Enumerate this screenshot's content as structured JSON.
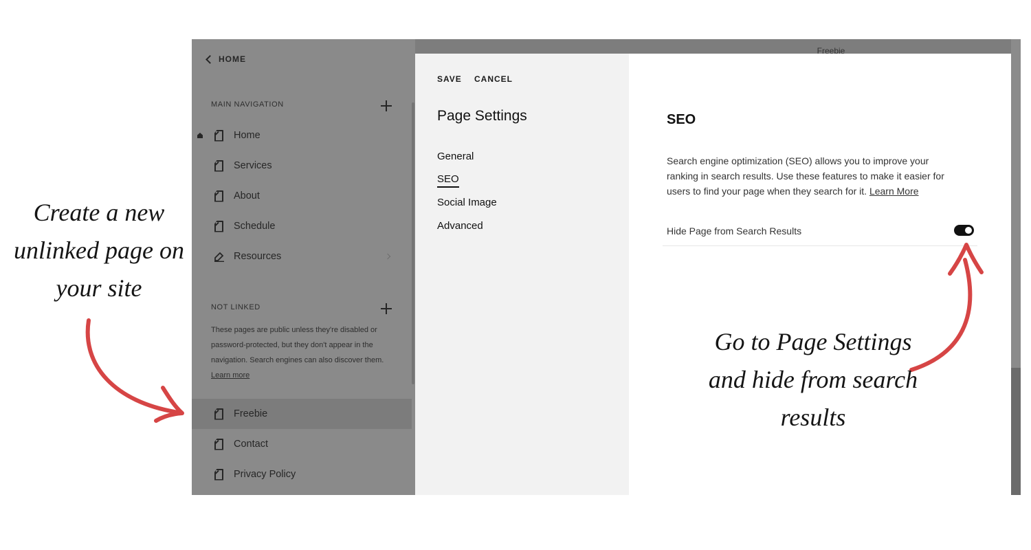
{
  "annotations": {
    "left_text": "Create a new unlinked page on your site",
    "right_text": "Go to Page Settings and hide from search results",
    "arrow_color": "#d64545"
  },
  "sidebar": {
    "back_label": "HOME",
    "main_nav_heading": "MAIN NAVIGATION",
    "main_nav_items": [
      {
        "label": "Home",
        "icon": "page-icon",
        "is_homepage": true
      },
      {
        "label": "Services",
        "icon": "page-icon"
      },
      {
        "label": "About",
        "icon": "page-icon"
      },
      {
        "label": "Schedule",
        "icon": "page-icon"
      },
      {
        "label": "Resources",
        "icon": "edit-icon",
        "has_submenu": true
      }
    ],
    "not_linked_heading": "NOT LINKED",
    "not_linked_description": "These pages are public unless they're disabled or password-protected, but they don't appear in the navigation. Search engines can also discover them.",
    "not_linked_learn_more": "Learn more",
    "not_linked_items": [
      {
        "label": "Freebie",
        "icon": "page-icon",
        "selected": true
      },
      {
        "label": "Contact",
        "icon": "page-icon"
      },
      {
        "label": "Privacy Policy",
        "icon": "page-icon"
      }
    ]
  },
  "preview": {
    "page_title": "Freebie"
  },
  "modal": {
    "save_label": "SAVE",
    "cancel_label": "CANCEL",
    "title": "Page Settings",
    "tabs": [
      {
        "label": "General"
      },
      {
        "label": "SEO",
        "active": true
      },
      {
        "label": "Social Image"
      },
      {
        "label": "Advanced"
      }
    ],
    "seo": {
      "heading": "SEO",
      "description": "Search engine optimization (SEO) allows you to improve your ranking in search results. Use these features to make it easier for users to find your page when they search for it.",
      "learn_more": "Learn More",
      "toggle_label": "Hide Page from Search Results",
      "toggle_on": true
    }
  }
}
